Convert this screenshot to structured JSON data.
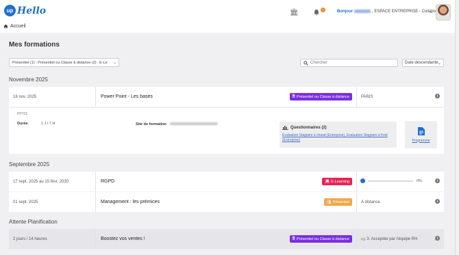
{
  "header": {
    "logo_up": "up",
    "logo_hello": "Hello",
    "greeting_hello": "Bonjour",
    "greeting_rest": ", ESPACE ENTREPRISE - Collaborateur"
  },
  "breadcrumb": {
    "label": "Accueil"
  },
  "page_title": "Mes formations",
  "filters": {
    "type_filter": "Présentiel (1) ; Présentiel ou Classe à distance (2) ; E-Le",
    "search_placeholder": "Chercher",
    "sort_value": "Date descendante"
  },
  "sections": [
    {
      "label": "Novembre 2025",
      "rows": [
        {
          "date": "18 nov. 2025",
          "title": "Power Point - Les bases",
          "badge": "Présentiel ou Classe à distance",
          "status": "PARIS"
        }
      ]
    },
    {
      "label": "Septembre 2025",
      "rows": [
        {
          "date": "17 sept. 2025 au 15 févr. 2030",
          "title": "RGPD",
          "badge": "E-Learning",
          "progress_text": "0%",
          "progress": 0
        },
        {
          "date": "01 sept. 2025",
          "title": "Management : les prémices",
          "badge": "Présentiel",
          "status": "A distance"
        }
      ]
    },
    {
      "label": "Attente Planification",
      "rows": [
        {
          "date": "2 jours / 14 heures",
          "title": "Boostez vos ventes !",
          "badge": "Présentiel ou Classe à distance",
          "status": "3. Acceptée par l'équipe RH"
        }
      ]
    }
  ],
  "detail": {
    "code": "PPT01",
    "duree_label": "Durée",
    "duree_value": "1 J / 7 H",
    "site_label": "Site de formation",
    "questionnaires_title": "Questionnaires (2)",
    "questionnaires_links": "Evaluation Stagiaire à chaud (Entreprise), Evaluation Stagiaire à froid (Entreprise)",
    "programme_label": "Programme"
  },
  "colors": {
    "brand": "#1f6fd1",
    "badge_classe": "#7b2fe0",
    "badge_elearning": "#e8245a",
    "badge_presentiel": "#f0a84a"
  }
}
